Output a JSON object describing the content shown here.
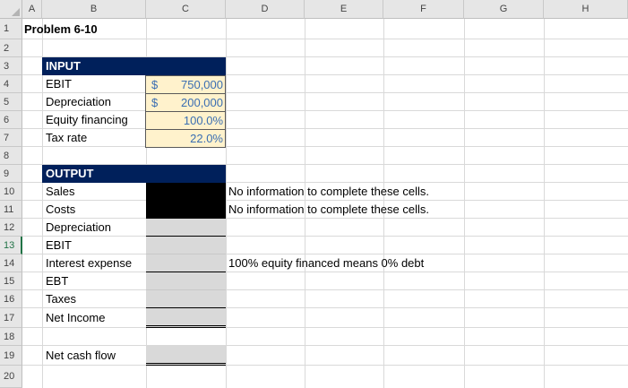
{
  "columns": [
    "A",
    "B",
    "C",
    "D",
    "E",
    "F",
    "G",
    "H"
  ],
  "rows": [
    "1",
    "2",
    "3",
    "4",
    "5",
    "6",
    "7",
    "8",
    "9",
    "10",
    "11",
    "12",
    "13",
    "14",
    "15",
    "16",
    "17",
    "18",
    "19",
    "20"
  ],
  "selected_row": "13",
  "title": "Problem 6-10",
  "input": {
    "header": "INPUT",
    "ebit_label": "EBIT",
    "ebit_currency": "$",
    "ebit_value": "750,000",
    "dep_label": "Depreciation",
    "dep_currency": "$",
    "dep_value": "200,000",
    "equity_label": "Equity financing",
    "equity_value": "100.0%",
    "tax_label": "Tax rate",
    "tax_value": "22.0%"
  },
  "output": {
    "header": "OUTPUT",
    "sales_label": "Sales",
    "costs_label": "Costs",
    "dep_label": "Depreciation",
    "ebit_label": "EBIT",
    "interest_label": "Interest expense",
    "ebt_label": "EBT",
    "taxes_label": "Taxes",
    "net_income_label": "Net Income",
    "net_cash_flow_label": "Net cash flow"
  },
  "notes": {
    "sales_note": "No information to complete these cells.",
    "costs_note": "No information to complete these cells.",
    "interest_note": "100% equity financed means 0% debt"
  },
  "colors": {
    "header_band": "#00205b",
    "input_fill": "#fff2cc",
    "input_text": "#3a6eb2",
    "output_fill": "#d9d9d9",
    "selection_green": "#217346"
  }
}
